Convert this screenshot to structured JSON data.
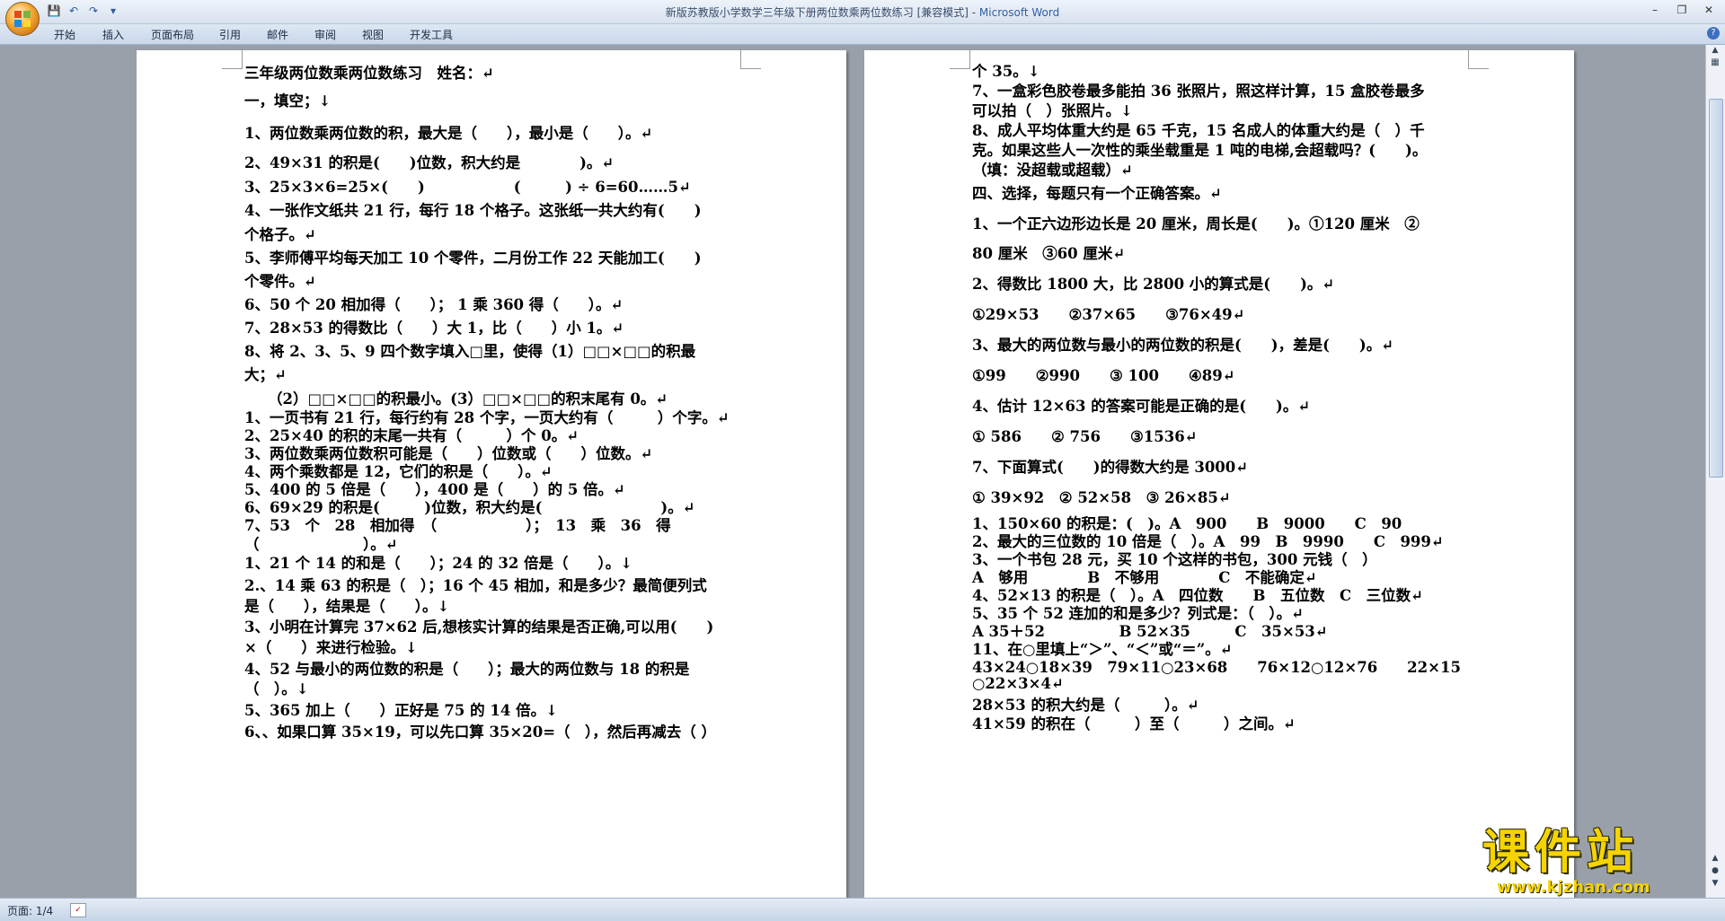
{
  "window": {
    "title": "新版苏教版小学数学三年级下册两位数乘两位数练习 [兼容模式] - ",
    "app_name": "Microsoft Word",
    "minimize_label": "–",
    "maximize_label": "❐",
    "close_label": "✕"
  },
  "quick_access": {
    "save_icon": "save-icon",
    "undo_icon": "undo-icon",
    "redo_icon": "redo-icon",
    "customize_icon": "dropdown-icon"
  },
  "ribbon": {
    "tabs": [
      "开始",
      "插入",
      "页面布局",
      "引用",
      "邮件",
      "审阅",
      "视图",
      "开发工具"
    ],
    "help_label": "?"
  },
  "colors": {
    "accent": "#2f5fa8",
    "watermark": "#f5d400"
  },
  "left_page_lines": [
    "三年级两位数乘两位数练习　姓名：↵",
    "一，填空；↓",
    "1、两位数乘两位数的积，最大是（　　），最小是（　　）。↵",
    "2、49×31 的积是(　　)位数，积大约是　　　　)。↵",
    "3、25×3×6=25×(　　)　　　　　　(　　　) ÷ 6=60……5↵",
    "4、一张作文纸共 21 行，每行 18 个格子。这张纸一共大约有(　　)",
    "个格子。↵",
    "5、李师傅平均每天加工 10 个零件，二月份工作 22 天能加工(　　)",
    "个零件。↵",
    "6、50 个 20 相加得（　　）；  1 乘 360 得（　　）。↵",
    "7、28×53 的得数比（　　）大 1，比（　　）小 1。↵",
    "8、将 2、3、5、9 四个数字填入□里，使得（1）□□×□□的积最",
    "大；↵",
    "（2）□□×□□的积最小。(3）□□×□□的积末尾有 0。↵",
    "1、一页书有 21 行，每行约有 28 个字，一页大约有（　　　）个字。↵",
    "2、25×40 的积的末尾一共有（　　　）个 0。↵",
    "3、两位数乘两位数积可能是（　　）位数或（　　）位数。↵",
    "4、两个乘数都是 12，它们的积是（　　）。↵",
    "5、400 的 5 倍是（　　），400 是（　　）的 5 倍。↵",
    "6、69×29 的积是(　　　)位数，积大约是(　　　　　　　　)。↵",
    "7、53　个　28　相加得　（　　　　　　）；　13　乘　36　得",
    "（　　　　　　　）。↵",
    "1、21 个 14 的和是（　　）；24 的 32 倍是（　　）。↓",
    "2.、14 乘 63 的积是（　）；16 个 45 相加，和是多少？最简便列式",
    "是（　　），结果是（　　）。↓",
    "3、小明在计算完 37×62 后,想核实计算的结果是否正确,可以用(　　)",
    "×（　　）来进行检验。↓",
    "4、52 与最小的两位数的积是（　　）；最大的两位数与 18 的积是",
    "（　）。↓",
    "5、365 加上（　　）正好是 75 的 14 倍。↓",
    "6、、如果口算 35×19，可以先口算 35×20=（　），然后再减去（ ）"
  ],
  "right_page_lines": [
    "个 35。↓",
    "7、一盒彩色胶卷最多能拍 36 张照片，照这样计算，15 盒胶卷最多",
    "可以拍（　）张照片。↓",
    "8、成人平均体重大约是 65 千克，15 名成人的体重大约是（　）千",
    "克。如果这些人一次性的乘坐载重是 1 吨的电梯,会超载吗？(　　)。",
    "（填：没超载或超载）↵",
    "四、选择，每题只有一个正确答案。↵",
    "1、一个正六边形边长是 20 厘米，周长是(　　)。①120 厘米　②",
    "80 厘米　③60 厘米↵",
    "2、得数比 1800 大，比 2800 小的算式是(　　)。↵",
    "①29×53　　②37×65　　③76×49↵",
    "3、最大的两位数与最小的两位数的积是(　　)，差是(　　)。↵",
    "①99　　②990　　③ 100　　④89↵",
    "4、估计 12×63 的答案可能是正确的是(　　)。↵",
    "① 586　　② 756　　③1536↵",
    "7、下面算式(　　)的得数大约是 3000↵",
    "① 39×92　② 52×58　③ 26×85↵",
    "1、150×60 的积是：(　)。A　900　　B　9000　　C　90",
    "2、最大的三位数的 10 倍是（　）。A　99　B　9990　　C　999↵",
    "3、一个书包 28 元，买 10 个这样的书包，300 元钱（　）",
    "A　够用　　　　B　不够用　　　　C　不能确定↵",
    "4、52×13 的积是（　）。A　四位数　　B　五位数　C　三位数↵",
    "5、35 个 52 连加的和是多少？列式是：（　）。↵",
    "A 35＋52　　　　　B 52×35　　　C　35×53↵",
    "11、在○里填上“＞”、“＜”或“＝”。↵",
    "43×24○18×39　79×11○23×68　　76×12○12×76　　22×15",
    "○22×3×4↵",
    "28×53 的积大约是（　　　）。↵",
    "41×59 的积在（　　　）至（　　　）之间。↵"
  ],
  "status": {
    "page_label": "页面: 1/4"
  },
  "watermark": {
    "brand": "课件站",
    "url": "www.kjzhan.com"
  }
}
